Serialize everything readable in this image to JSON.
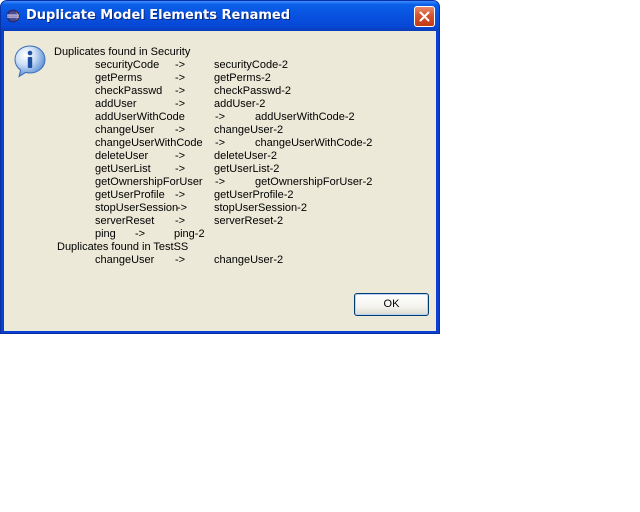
{
  "window": {
    "title": "Duplicate Model Elements Renamed",
    "icon": "eclipse-app-icon",
    "close_icon": "close-icon"
  },
  "message": {
    "icon": "info-icon",
    "groups": [
      {
        "header": "Duplicates found in Security",
        "rows": [
          {
            "original": "securityCode",
            "arrow": "->",
            "renamed": "securityCode-2"
          },
          {
            "original": "getPerms",
            "arrow": "->",
            "renamed": "getPerms-2"
          },
          {
            "original": "checkPasswd",
            "arrow": "->",
            "renamed": "checkPasswd-2"
          },
          {
            "original": "addUser",
            "arrow": "->",
            "renamed": "addUser-2"
          },
          {
            "original": "addUserWithCode",
            "arrow": "->",
            "renamed": "addUserWithCode-2"
          },
          {
            "original": "changeUser",
            "arrow": "->",
            "renamed": "changeUser-2"
          },
          {
            "original": "changeUserWithCode",
            "arrow": "->",
            "renamed": "changeUserWithCode-2"
          },
          {
            "original": "deleteUser",
            "arrow": "->",
            "renamed": "deleteUser-2"
          },
          {
            "original": "getUserList",
            "arrow": "->",
            "renamed": "getUserList-2"
          },
          {
            "original": "getOwnershipForUser",
            "arrow": "->",
            "renamed": "getOwnershipForUser-2"
          },
          {
            "original": "getUserProfile",
            "arrow": "->",
            "renamed": "getUserProfile-2"
          },
          {
            "original": "stopUserSession",
            "arrow": "->",
            "renamed": "stopUserSession-2"
          },
          {
            "original": "serverReset",
            "arrow": "->",
            "renamed": "serverReset-2"
          },
          {
            "original": "ping",
            "arrow": "->",
            "renamed": "ping-2"
          }
        ]
      },
      {
        "header": "Duplicates found in TestSS",
        "rows": [
          {
            "original": "changeUser",
            "arrow": "->",
            "renamed": "changeUser-2"
          }
        ]
      }
    ]
  },
  "buttons": {
    "ok_label": "OK"
  },
  "colors": {
    "titlebar": "#0851e0",
    "client_bg": "#ece9d8",
    "close_button": "#d5542e"
  }
}
